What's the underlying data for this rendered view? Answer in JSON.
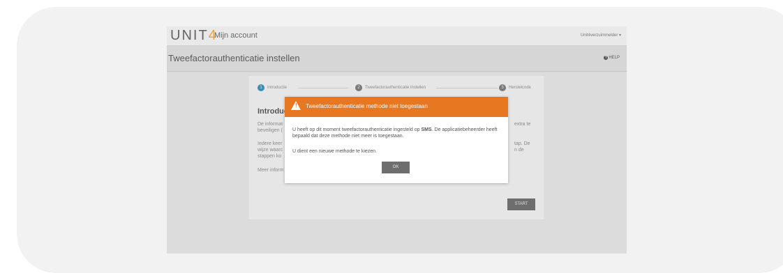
{
  "app": {
    "logo": "UNIT",
    "logo_mark": "4",
    "name": "Mijn account",
    "user": "Unit4verzuimmelder ▾"
  },
  "page": {
    "title": "Tweefactorauthenticatie instellen",
    "help": "HELP"
  },
  "wizard": {
    "steps": [
      {
        "num": "1",
        "label": "Introductie",
        "active": true
      },
      {
        "num": "2",
        "label": "Tweefactorauthenticatie instellen",
        "active": false
      },
      {
        "num": "3",
        "label": "Herstelcode",
        "active": false
      }
    ],
    "intro_title": "Introduct",
    "para1_left": "De informat",
    "para1_left2": "beveiligen (",
    "para1_right": "extra te",
    "para2_left": "Iedere keer",
    "para2_left2": "wijze waarc",
    "para2_left3": "stappen ko",
    "para2_right": "tap. De",
    "para2_right2": "n de",
    "para3_left": "Meer inform",
    "start": "START"
  },
  "dialog": {
    "title": "Tweefactorauthenticatie methode niet toegestaan",
    "body_prefix": "U heeft op dit moment tweefactorauthenticatie ingesteld op ",
    "body_bold": "SMS",
    "body_suffix": ". De applicatiebeheerder heeft bepaald dat deze methode niet meer is toegestaan.",
    "body2": "U dient een nieuwe methode te kiezen.",
    "ok": "OK"
  },
  "colors": {
    "accent": "#e87722",
    "step_active": "#3a8fb5"
  }
}
